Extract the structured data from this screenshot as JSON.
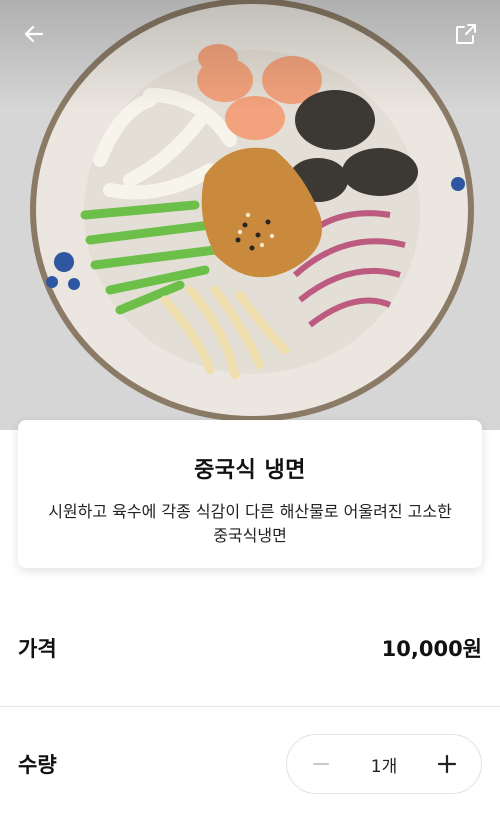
{
  "header": {
    "back_icon": "arrow-left-icon",
    "share_icon": "share-external-icon"
  },
  "menu": {
    "name": "중국식 냉면",
    "description": "시원하고 육수에 각종 식감이 다른 해산물로 어울려진 고소한 중국식냉면"
  },
  "price": {
    "label": "가격",
    "value": "10,000원"
  },
  "quantity": {
    "label": "수량",
    "value": "1개",
    "decrement_icon": "minus-icon",
    "increment_icon": "plus-icon"
  },
  "colors": {
    "bowl": "#eae6df",
    "sauce": "#c98a3e",
    "cucumber": "#6cc04a",
    "onion": "#b9537a",
    "shrimp": "#f0a07a",
    "squid": "#f4f1e8",
    "jellyfish": "#eedfb0",
    "seaweed": "#3e3a36"
  }
}
